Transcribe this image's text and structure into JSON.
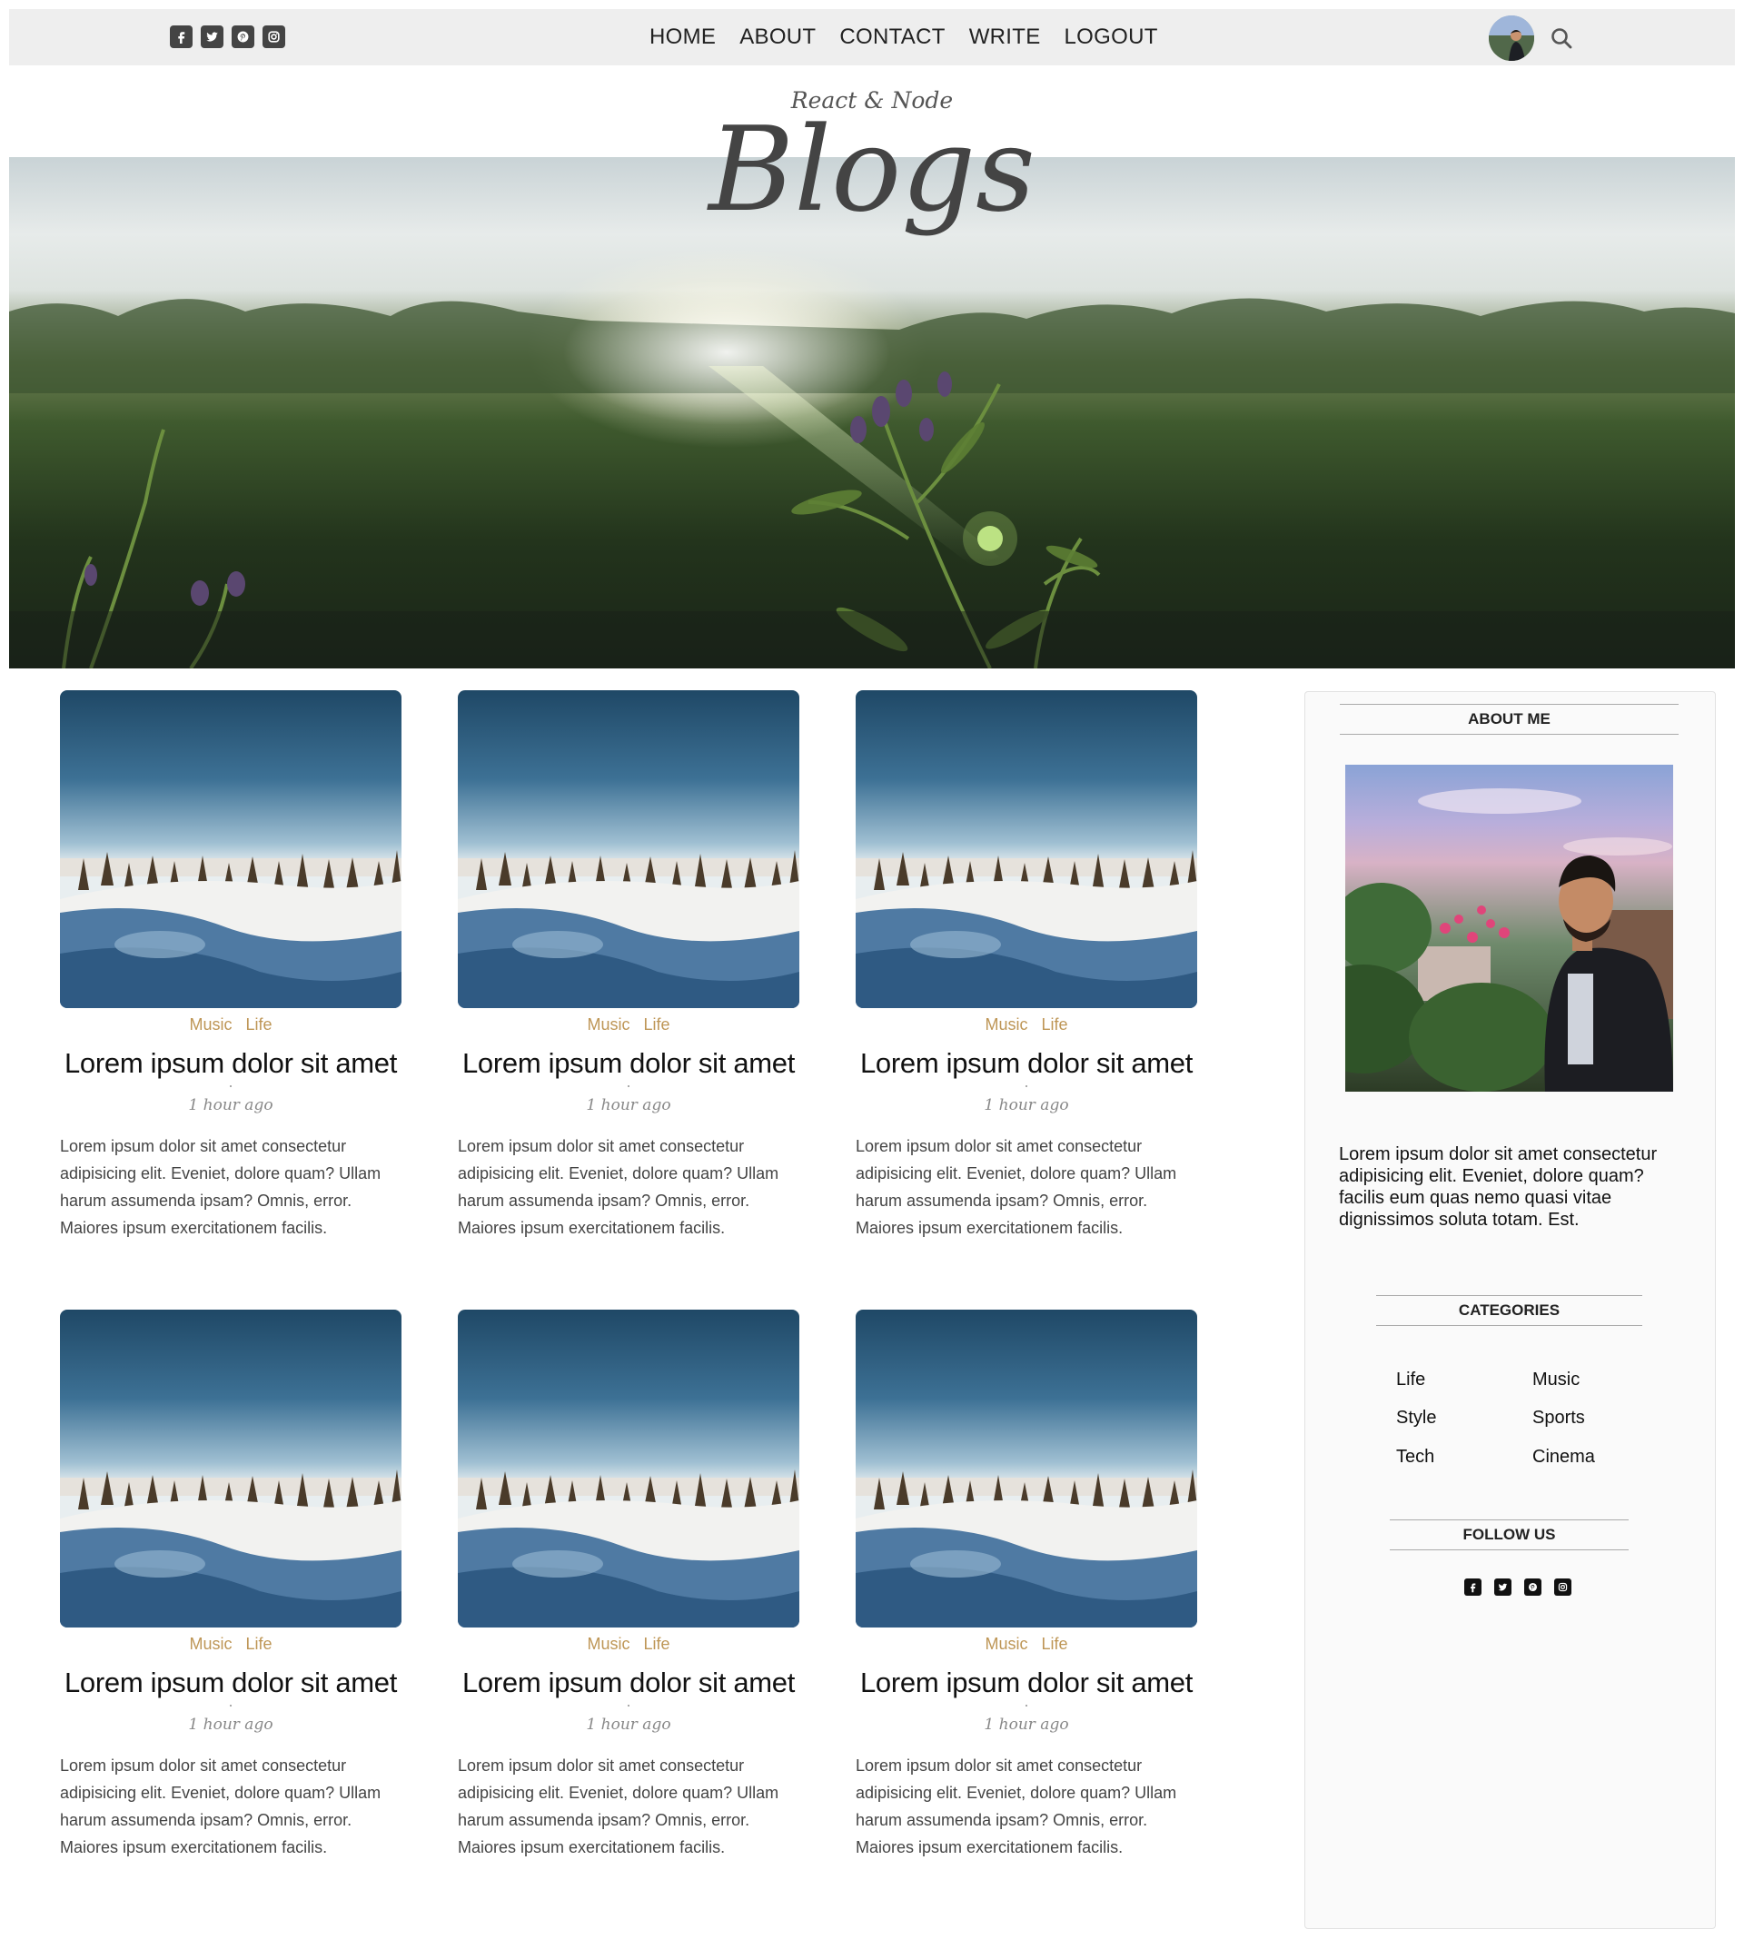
{
  "topbar": {
    "social_icons": [
      "facebook-square-icon",
      "twitter-square-icon",
      "pinterest-square-icon",
      "instagram-square-icon"
    ],
    "nav": [
      "HOME",
      "ABOUT",
      "CONTACT",
      "WRITE",
      "LOGOUT"
    ]
  },
  "header": {
    "subtitle": "React & Node",
    "title": "Blogs"
  },
  "posts": [
    {
      "cats": [
        "Music",
        "Life"
      ],
      "title": "Lorem ipsum dolor sit amet",
      "date": "1 hour ago",
      "desc": "Lorem ipsum dolor sit amet consectetur adipisicing elit. Eveniet, dolore quam? Ullam harum assumenda ipsam? Omnis, error. Maiores ipsum exercitationem facilis."
    },
    {
      "cats": [
        "Music",
        "Life"
      ],
      "title": "Lorem ipsum dolor sit amet",
      "date": "1 hour ago",
      "desc": "Lorem ipsum dolor sit amet consectetur adipisicing elit. Eveniet, dolore quam? Ullam harum assumenda ipsam? Omnis, error. Maiores ipsum exercitationem facilis."
    },
    {
      "cats": [
        "Music",
        "Life"
      ],
      "title": "Lorem ipsum dolor sit amet",
      "date": "1 hour ago",
      "desc": "Lorem ipsum dolor sit amet consectetur adipisicing elit. Eveniet, dolore quam? Ullam harum assumenda ipsam? Omnis, error. Maiores ipsum exercitationem facilis."
    },
    {
      "cats": [
        "Music",
        "Life"
      ],
      "title": "Lorem ipsum dolor sit amet",
      "date": "1 hour ago",
      "desc": "Lorem ipsum dolor sit amet consectetur adipisicing elit. Eveniet, dolore quam? Ullam harum assumenda ipsam? Omnis, error. Maiores ipsum exercitationem facilis."
    },
    {
      "cats": [
        "Music",
        "Life"
      ],
      "title": "Lorem ipsum dolor sit amet",
      "date": "1 hour ago",
      "desc": "Lorem ipsum dolor sit amet consectetur adipisicing elit. Eveniet, dolore quam? Ullam harum assumenda ipsam? Omnis, error. Maiores ipsum exercitationem facilis."
    },
    {
      "cats": [
        "Music",
        "Life"
      ],
      "title": "Lorem ipsum dolor sit amet",
      "date": "1 hour ago",
      "desc": "Lorem ipsum dolor sit amet consectetur adipisicing elit. Eveniet, dolore quam? Ullam harum assumenda ipsam? Omnis, error. Maiores ipsum exercitationem facilis."
    }
  ],
  "sidebar": {
    "about_title": "ABOUT ME",
    "about_text": "Lorem ipsum dolor sit amet consectetur adipisicing elit. Eveniet, dolore quam? facilis eum quas nemo quasi vitae dignissimos soluta totam. Est.",
    "categories_title": "CATEGORIES",
    "categories": [
      "Life",
      "Music",
      "Style",
      "Sports",
      "Tech",
      "Cinema"
    ],
    "follow_title": "FOLLOW US",
    "follow_icons": [
      "facebook-square-icon",
      "twitter-square-icon",
      "pinterest-square-icon",
      "instagram-square-icon"
    ]
  },
  "colors": {
    "topbar_bg": "#eeeeee",
    "category_accent": "#be9656",
    "sidebar_bg": "#fafafa"
  }
}
